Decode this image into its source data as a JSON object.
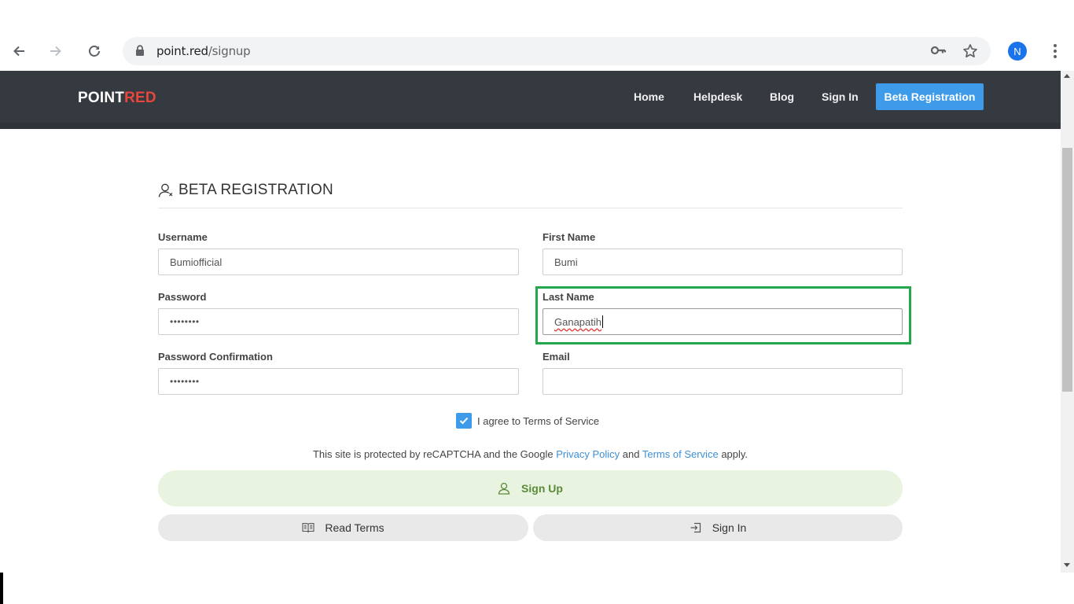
{
  "browser": {
    "url_host": "point.red",
    "url_path": "/signup",
    "profile_initial": "N",
    "icons": [
      "back-icon",
      "forward-icon",
      "reload-icon",
      "lock-icon",
      "key-icon",
      "star-icon",
      "menu-kebab-icon"
    ]
  },
  "site": {
    "logo_part1": "POINT",
    "logo_part2": "RED",
    "nav": [
      "Home",
      "Helpdesk",
      "Blog",
      "Sign In"
    ],
    "cta": "Beta Registration"
  },
  "form": {
    "title": "BETA REGISTRATION",
    "username_label": "Username",
    "username_value": "Bumiofficial",
    "first_name_label": "First Name",
    "first_name_value": "Bumi",
    "password_label": "Password",
    "password_value": "••••••••",
    "last_name_label": "Last Name",
    "last_name_value": "Ganapatih",
    "password_confirm_label": "Password Confirmation",
    "password_confirm_value": "••••••••",
    "email_label": "Email",
    "email_value": "",
    "terms_checkbox_label": "I agree to Terms of Service",
    "terms_checked": true,
    "recaptcha_prefix": "This site is protected by reCAPTCHA and the Google",
    "privacy_link": "Privacy Policy",
    "recaptcha_and": "and",
    "tos_link": "Terms of Service",
    "recaptcha_suffix": "apply.",
    "signup_button": "Sign Up",
    "read_terms_button": "Read Terms",
    "sign_in_button": "Sign In"
  },
  "colors": {
    "header_bg": "#353a41",
    "accent_blue": "#3d9be9",
    "logo_red": "#e8473c",
    "highlight_green": "#22a84a",
    "signup_bg": "#e8f3e0"
  }
}
